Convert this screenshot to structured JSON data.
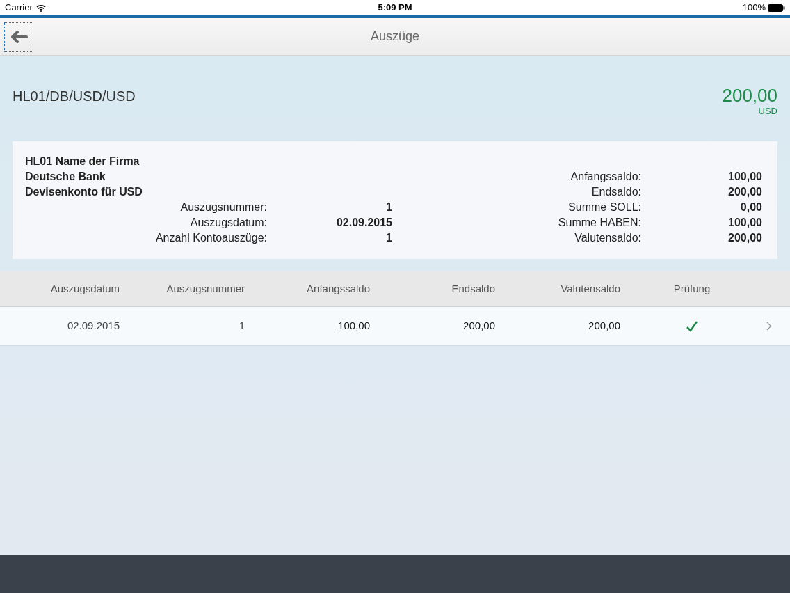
{
  "status_bar": {
    "carrier": "Carrier",
    "time": "5:09 PM",
    "battery": "100%"
  },
  "nav_bar": {
    "title": "Auszüge"
  },
  "account": {
    "name": "HL01/DB/USD/USD",
    "amount": "200,00",
    "currency": "USD"
  },
  "summary": {
    "lines": [
      "HL01 Name der Firma",
      "Deutsche Bank",
      "Devisenkonto für USD"
    ],
    "left_fields": [
      {
        "label": "Auszugsnummer:",
        "value": "1"
      },
      {
        "label": "Auszugsdatum:",
        "value": "02.09.2015"
      },
      {
        "label": "Anzahl Kontoauszüge:",
        "value": "1"
      }
    ],
    "right_fields": [
      {
        "label": "Anfangssaldo:",
        "value": "100,00"
      },
      {
        "label": "Endsaldo:",
        "value": "200,00"
      },
      {
        "label": "Summe SOLL:",
        "value": "0,00"
      },
      {
        "label": "Summe HABEN:",
        "value": "100,00"
      },
      {
        "label": "Valutensaldo:",
        "value": "200,00"
      }
    ]
  },
  "table": {
    "columns": [
      "Auszugsdatum",
      "Auszugsnummer",
      "Anfangssaldo",
      "Endsaldo",
      "Valutensaldo",
      "Prüfung"
    ],
    "rows": [
      {
        "cells": [
          "02.09.2015",
          "1",
          "100,00",
          "200,00",
          "200,00"
        ],
        "checked": true
      }
    ]
  }
}
